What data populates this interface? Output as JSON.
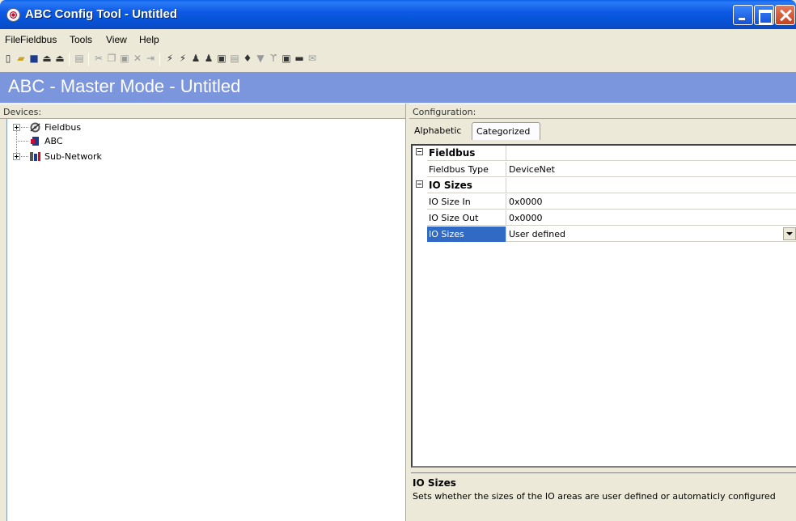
{
  "window": {
    "title": "ABC Config Tool - Untitled",
    "icon": "app-logo-icon"
  },
  "menu": [
    {
      "label": "File",
      "left": 0
    },
    {
      "label": "Fieldbus"
    },
    {
      "label": "Tools"
    },
    {
      "label": "View"
    },
    {
      "label": "Help"
    }
  ],
  "banner": {
    "text": "ABC - Master Mode - Untitled",
    "color": "#7b96dc"
  },
  "devices": {
    "header": "Devices:",
    "nodes": [
      {
        "label": "Fieldbus",
        "icon": "fieldbus-icon",
        "expandable": true
      },
      {
        "label": "ABC",
        "icon": "abc-device-icon",
        "expandable": false
      },
      {
        "label": "Sub-Network",
        "icon": "sub-network-icon",
        "expandable": true
      }
    ]
  },
  "configuration": {
    "header": "Configuration:",
    "tabs": [
      "Alphabetic",
      "Categorized"
    ],
    "active_tab": "Categorized",
    "categories": [
      {
        "name": "Fieldbus",
        "properties": [
          {
            "name": "Fieldbus Type",
            "value": "DeviceNet"
          }
        ]
      },
      {
        "name": "IO Sizes",
        "properties": [
          {
            "name": "IO Size In",
            "value": "0x0000"
          },
          {
            "name": "IO Size Out",
            "value": "0x0000"
          },
          {
            "name": "IO Sizes",
            "value": "User defined",
            "selected": true
          }
        ]
      }
    ],
    "description": {
      "title": "IO Sizes",
      "text": "Sets whether the sizes of the IO areas are user defined or automaticly configured"
    },
    "selection_color": "#316ac5"
  }
}
